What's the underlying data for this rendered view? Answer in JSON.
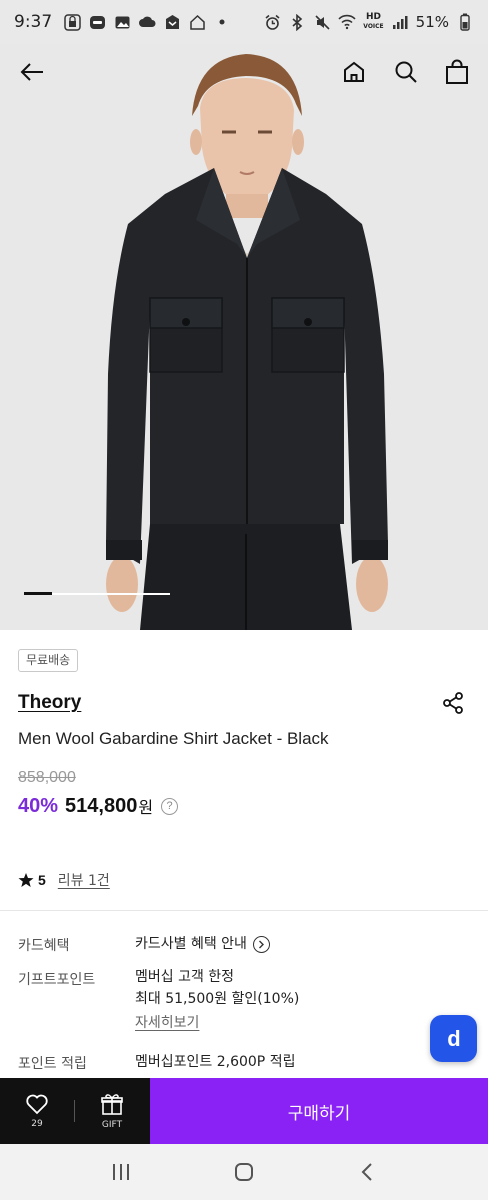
{
  "status_bar": {
    "time": "9:37",
    "battery": "51%",
    "hd_top": "HD",
    "hd_bottom": "VOICE"
  },
  "nav": {
    "icons": [
      "back-arrow-icon",
      "home-icon",
      "search-icon",
      "shopping-bag-icon"
    ]
  },
  "carousel": {
    "active_index": 0
  },
  "product": {
    "badge": "무료배송",
    "brand": "Theory",
    "name": "Men Wool Gabardine Shirt Jacket - Black",
    "original_price": "858,000",
    "discount": "40%",
    "price": "514,800",
    "currency": "원",
    "help": "?"
  },
  "rating": {
    "value": "5",
    "review_text": "리뷰 1건"
  },
  "benefits": {
    "card_label": "카드혜택",
    "card_value": "카드사별 혜택 안내",
    "gift_label": "기프트포인트",
    "gift_line1": "멤버십 고객 한정",
    "gift_line2": "최대 51,500원 할인(10%)",
    "gift_link": "자세히보기",
    "point_label": "포인트 적립",
    "point_value": "멤버십포인트 2,600P 적립"
  },
  "fab": {
    "label": "d"
  },
  "action_bar": {
    "like_count": "29",
    "gift_label": "GIFT",
    "buy_label": "구매하기"
  },
  "colors": {
    "accent_purple": "#8a21f5",
    "discount_purple": "#7b2cd8",
    "fab_blue": "#2355e8"
  }
}
